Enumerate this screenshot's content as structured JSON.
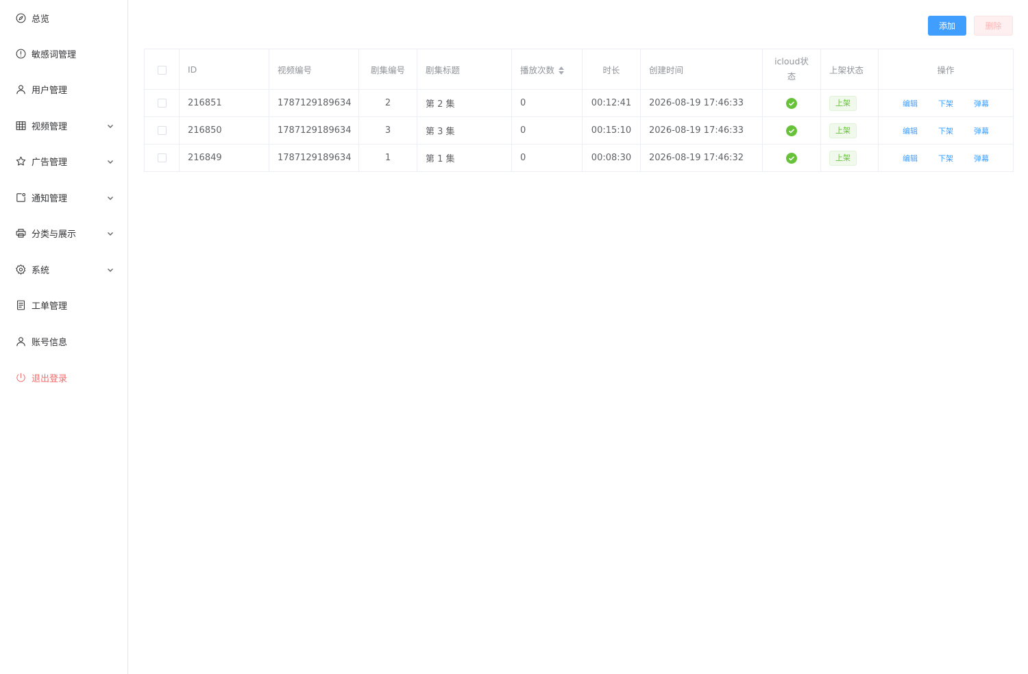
{
  "sidebar": {
    "items": [
      {
        "label": "总览",
        "icon": "compass-icon"
      },
      {
        "label": "敏感词管理",
        "icon": "alert-circle-icon"
      },
      {
        "label": "用户管理",
        "icon": "user-icon"
      },
      {
        "label": "视频管理",
        "icon": "grid-icon",
        "expandable": true
      },
      {
        "label": "广告管理",
        "icon": "star-icon",
        "expandable": true
      },
      {
        "label": "通知管理",
        "icon": "notification-icon",
        "expandable": true
      },
      {
        "label": "分类与展示",
        "icon": "printer-icon",
        "expandable": true
      },
      {
        "label": "系统",
        "icon": "gear-icon",
        "expandable": true
      },
      {
        "label": "工单管理",
        "icon": "document-icon"
      },
      {
        "label": "账号信息",
        "icon": "user-icon"
      },
      {
        "label": "退出登录",
        "icon": "power-icon"
      }
    ]
  },
  "toolbar": {
    "add_label": "添加",
    "delete_label": "删除"
  },
  "table": {
    "headers": {
      "id": "ID",
      "video_no": "视频编号",
      "episode_no": "剧集编号",
      "episode_title": "剧集标题",
      "play_count": "播放次数",
      "duration": "时长",
      "created_at": "创建时间",
      "icloud_status": "icloud状态",
      "shelf_status": "上架状态",
      "actions": "操作"
    },
    "rows": [
      {
        "id": "216851",
        "video_no": "1787129189634",
        "episode_no": "2",
        "episode_title": "第 2 集",
        "play_count": "0",
        "duration": "00:12:41",
        "created_at": "2026-08-19 17:46:33",
        "icloud_ok": true,
        "shelf_status": "上架",
        "actions": [
          "编辑",
          "下架",
          "弹幕"
        ]
      },
      {
        "id": "216850",
        "video_no": "1787129189634",
        "episode_no": "3",
        "episode_title": "第 3 集",
        "play_count": "0",
        "duration": "00:15:10",
        "created_at": "2026-08-19 17:46:33",
        "icloud_ok": true,
        "shelf_status": "上架",
        "actions": [
          "编辑",
          "下架",
          "弹幕"
        ]
      },
      {
        "id": "216849",
        "video_no": "1787129189634",
        "episode_no": "1",
        "episode_title": "第 1 集",
        "play_count": "0",
        "duration": "00:08:30",
        "created_at": "2026-08-19 17:46:32",
        "icloud_ok": true,
        "shelf_status": "上架",
        "actions": [
          "编辑",
          "下架",
          "弹幕"
        ]
      }
    ]
  },
  "colors": {
    "primary": "#409eff",
    "danger": "#f56c6c",
    "success": "#67c23a"
  }
}
